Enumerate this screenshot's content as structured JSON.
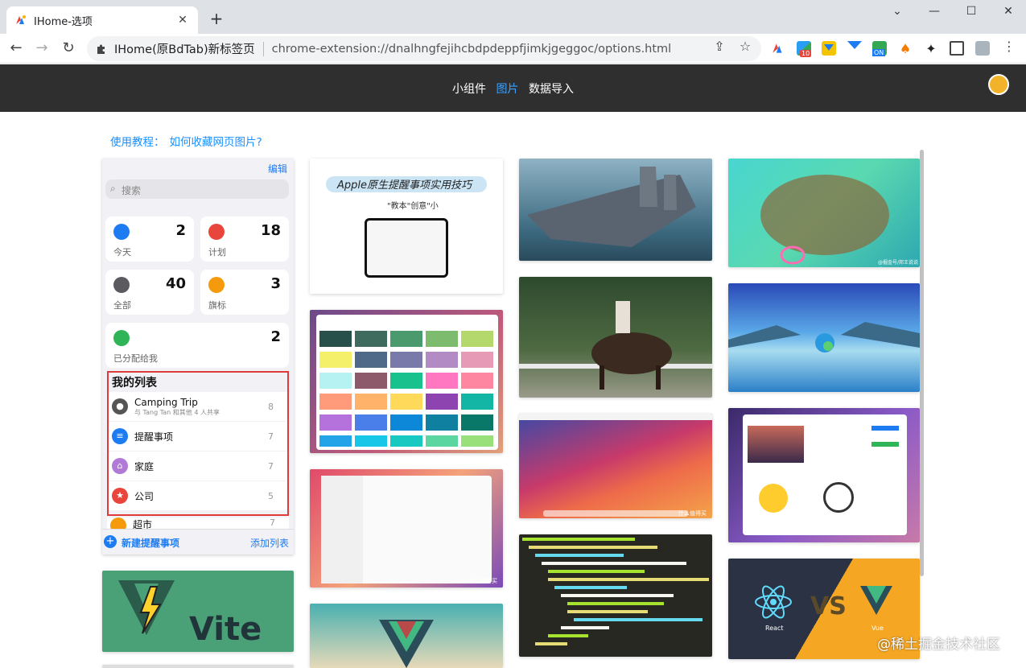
{
  "browser": {
    "tab_title": "IHome-选项",
    "close_tab": "✕",
    "new_tab": "+",
    "window_controls": [
      "⌄",
      "—",
      "☐",
      "✕"
    ],
    "omnibox_site": "IHome(原BdTab)新标签页",
    "omnibox_url": "chrome-extension://dnalhngfejihcbdpdeppfjimkjgeggoc/options.html",
    "ext_badges": [
      "10",
      "ON"
    ]
  },
  "app": {
    "nav": [
      "小组件",
      "图片",
      "数据导入"
    ],
    "active_nav": "图片"
  },
  "tutorial": {
    "label": "使用教程：",
    "link": "如何收藏网页图片?"
  },
  "reminders": {
    "edit": "编辑",
    "search_placeholder": "搜索",
    "tiles": [
      {
        "label": "今天",
        "count": "2",
        "color": "#1e7cf2"
      },
      {
        "label": "计划",
        "count": "18",
        "color": "#e8453c"
      },
      {
        "label": "全部",
        "count": "40",
        "color": "#5b5b5f"
      },
      {
        "label": "旗标",
        "count": "3",
        "color": "#f59a0c"
      },
      {
        "label": "已分配给我",
        "count": "2",
        "color": "#2fb457"
      }
    ],
    "my_lists_title": "我的列表",
    "lists": [
      {
        "name": "Camping Trip",
        "sub": "与 Tang Tan 和其他 4 人共享",
        "count": "8",
        "color": "#555"
      },
      {
        "name": "提醒事项",
        "sub": "",
        "count": "7",
        "color": "#1e7cf2"
      },
      {
        "name": "家庭",
        "sub": "",
        "count": "7",
        "color": "#b07ad6"
      },
      {
        "name": "公司",
        "sub": "",
        "count": "5",
        "color": "#e8453c"
      }
    ],
    "partial_list": "超市",
    "partial_count": "7",
    "new_reminder": "新建提醒事项",
    "add_list": "添加列表"
  },
  "images": {
    "apple_title": "Apple原生提醒事项实用技巧",
    "apple_sub": "\"教本\"创意\"小",
    "vite": "Vite",
    "react": "React",
    "vs": "VS",
    "vue": "Vue",
    "zhihu": "什么值得买",
    "watermark_small": "@掘金号/邦王说说道"
  },
  "page_watermark": "@稀土掘金技术社区"
}
